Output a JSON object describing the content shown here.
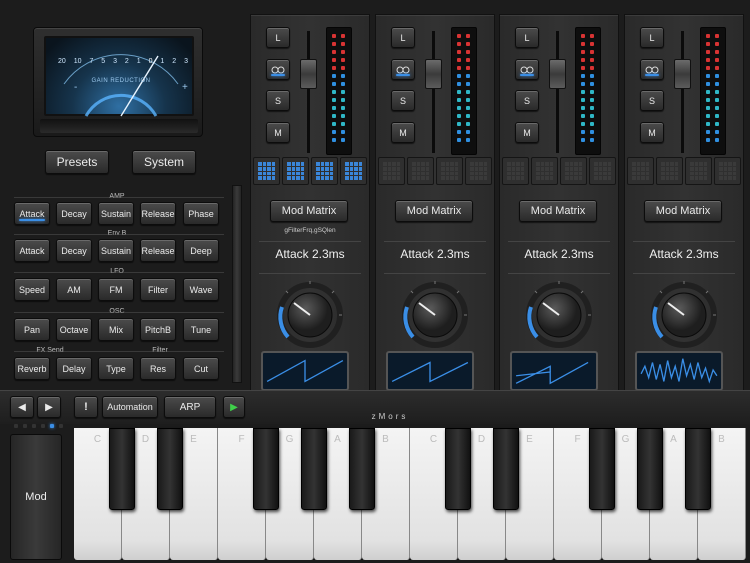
{
  "vu": {
    "scale": [
      "20",
      "10",
      "7",
      "5",
      "3",
      "2",
      "1",
      "0",
      "1",
      "2",
      "3"
    ],
    "label": "GAIN REDUCTION",
    "minus": "-",
    "plus": "+"
  },
  "top_buttons": {
    "presets": "Presets",
    "system": "System"
  },
  "groups": {
    "amp": {
      "label": "AMP",
      "buttons": [
        "Attack",
        "Decay",
        "Sustain",
        "Release",
        "Phase"
      ]
    },
    "envb": {
      "label": "Env B",
      "buttons": [
        "Attack",
        "Decay",
        "Sustain",
        "Release",
        "Deep"
      ]
    },
    "lfo": {
      "label": "LFO",
      "buttons": [
        "Speed",
        "AM",
        "FM",
        "Filter",
        "Wave"
      ]
    },
    "osc": {
      "label": "OSC",
      "buttons": [
        "Pan",
        "Octave",
        "Mix",
        "PitchB",
        "Tune"
      ]
    },
    "fx": {
      "label_left": "FX Send",
      "label_right": "Filter",
      "buttons": [
        "Reverb",
        "Delay",
        "Type",
        "Res",
        "Cut"
      ]
    }
  },
  "strips": [
    {
      "lsm": [
        "L",
        "",
        "S",
        "M"
      ],
      "mod_matrix": "Mod Matrix",
      "mod_sub": "gFilterFrq,gSQlen",
      "attack": "Attack 2.3ms"
    },
    {
      "lsm": [
        "L",
        "",
        "S",
        "M"
      ],
      "mod_matrix": "Mod Matrix",
      "mod_sub": "",
      "attack": "Attack 2.3ms"
    },
    {
      "lsm": [
        "L",
        "",
        "S",
        "M"
      ],
      "mod_matrix": "Mod Matrix",
      "mod_sub": "",
      "attack": "Attack 2.3ms"
    },
    {
      "lsm": [
        "L",
        "",
        "S",
        "M"
      ],
      "mod_matrix": "Mod Matrix",
      "mod_sub": "",
      "attack": "Attack 2.3ms"
    }
  ],
  "transport": {
    "prev": "◀",
    "next": "▶",
    "alert": "!",
    "automation": "Automation",
    "arp": "ARP",
    "play": "▶"
  },
  "brand": "zMors",
  "mod_wheel": "Mod",
  "keys": {
    "white": [
      "C",
      "D",
      "E",
      "F",
      "G",
      "A",
      "B",
      "C",
      "D",
      "E",
      "F",
      "G",
      "A",
      "B"
    ]
  },
  "colors": {
    "accent": "#3a8ee6",
    "meter_red": "#d83333",
    "meter_blue": "#2f8fe0",
    "meter_teal": "#2fb7c6"
  }
}
